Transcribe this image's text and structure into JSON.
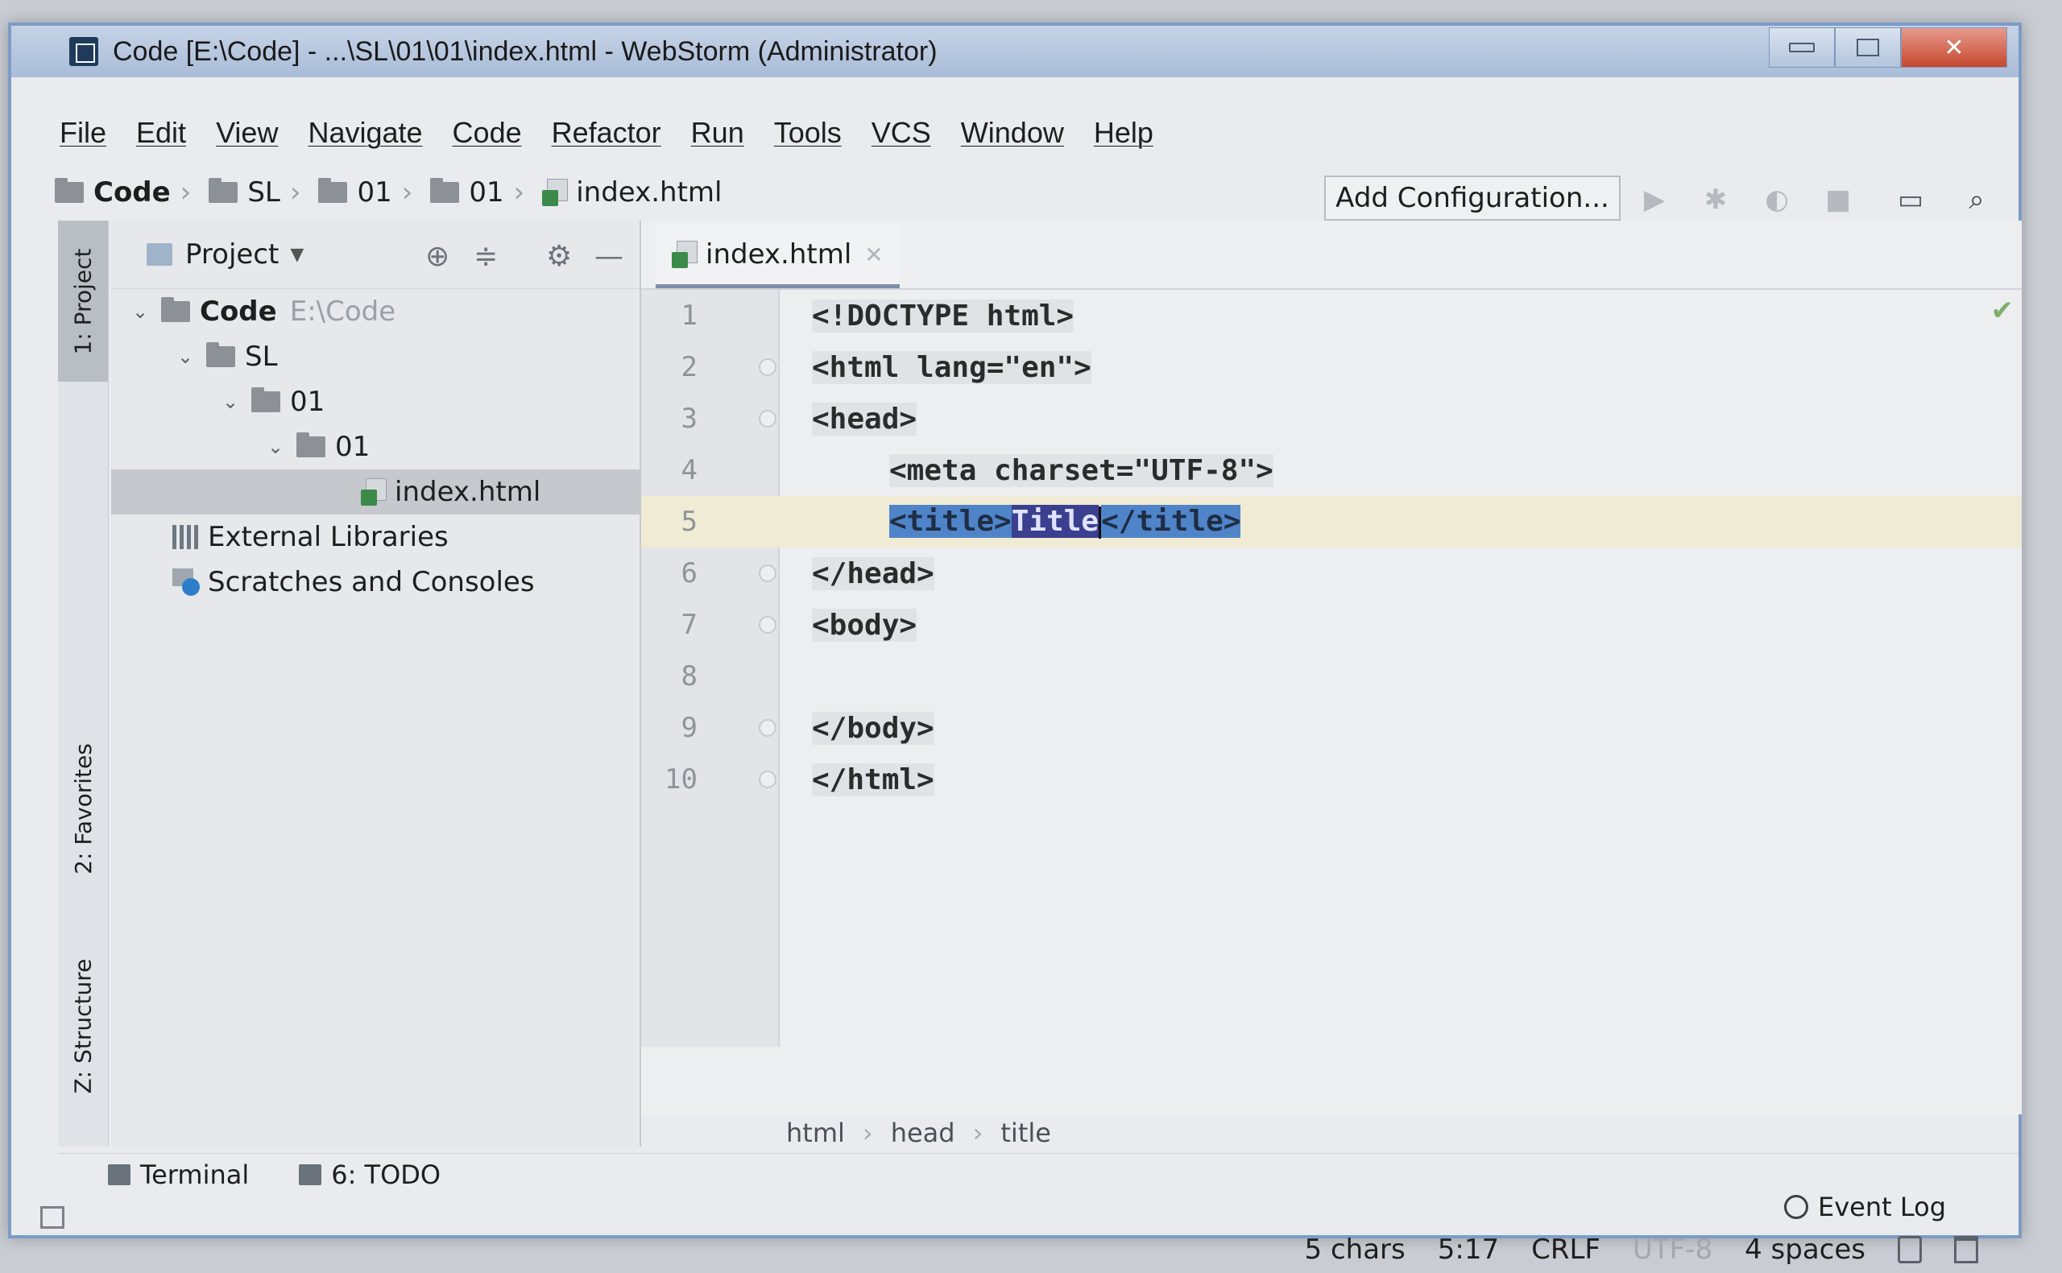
{
  "window": {
    "title": "Code [E:\\Code] - ...\\SL\\01\\01\\index.html - WebStorm (Administrator)"
  },
  "menu": [
    "File",
    "Edit",
    "View",
    "Navigate",
    "Code",
    "Refactor",
    "Run",
    "Tools",
    "VCS",
    "Window",
    "Help"
  ],
  "navbar": {
    "crumbs": [
      "Code",
      "SL",
      "01",
      "01",
      "index.html"
    ],
    "add_configuration": "Add Configuration..."
  },
  "side_tabs": {
    "project": "1: Project",
    "favorites": "2: Favorites",
    "structure": "Z: Structure"
  },
  "project_panel": {
    "title": "Project",
    "tree": {
      "root_name": "Code",
      "root_path": "E:\\Code",
      "sl": "SL",
      "folder_01a": "01",
      "folder_01b": "01",
      "file": "index.html",
      "external_libraries": "External Libraries",
      "scratches": "Scratches and Consoles"
    }
  },
  "editor": {
    "tab_label": "index.html",
    "lines": [
      {
        "num": "1",
        "text": "<!DOCTYPE html>"
      },
      {
        "num": "2",
        "text": "<html lang=\"en\">"
      },
      {
        "num": "3",
        "text": "<head>"
      },
      {
        "num": "4",
        "text": "<meta charset=\"UTF-8\">"
      },
      {
        "num": "5",
        "open_tag": "<title>",
        "content": "Title",
        "close_tag": "</title>"
      },
      {
        "num": "6",
        "text": "</head>"
      },
      {
        "num": "7",
        "text": "<body>"
      },
      {
        "num": "8",
        "text": ""
      },
      {
        "num": "9",
        "text": "</body>"
      },
      {
        "num": "10",
        "text": "</html>"
      }
    ],
    "breadcrumbs": [
      "html",
      "head",
      "title"
    ]
  },
  "tool_windows": {
    "terminal": "Terminal",
    "todo": "6: TODO",
    "event_log": "Event Log"
  },
  "status": {
    "chars": "5 chars",
    "position": "5:17",
    "line_sep": "CRLF",
    "encoding": "UTF-8",
    "indent": "4 spaces"
  }
}
